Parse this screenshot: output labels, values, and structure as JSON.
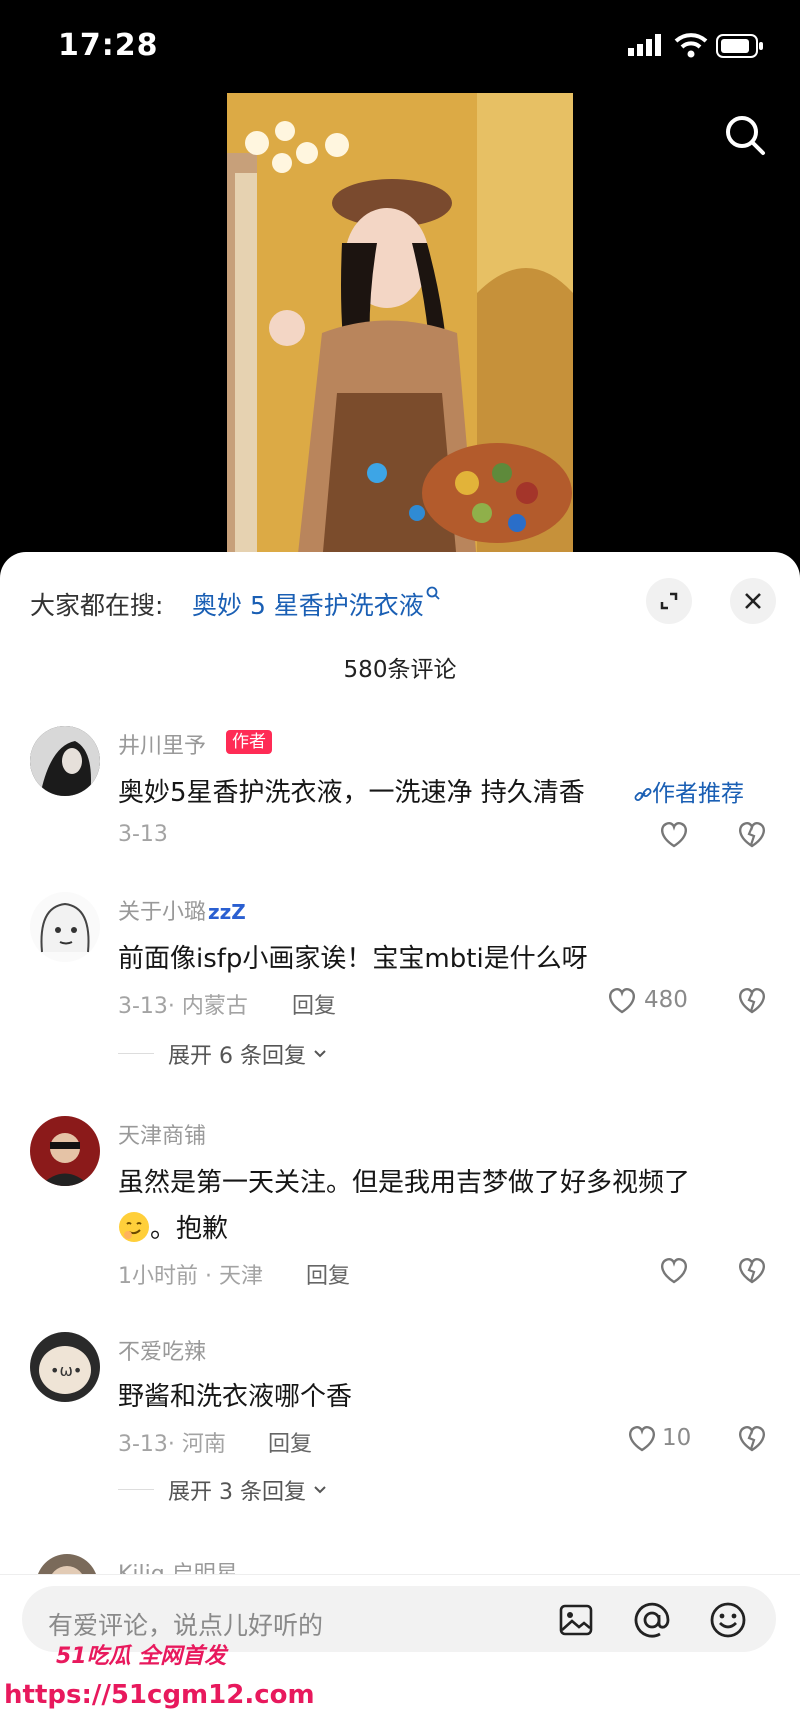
{
  "status_bar": {
    "time": "17:28"
  },
  "hot_search": {
    "label": "大家都在搜:",
    "term": "奥妙 5 星香护洗衣液"
  },
  "comment_count": "580条评论",
  "comments": [
    {
      "name": "井川里予",
      "badge": "作者",
      "text": "奥妙5星香护洗衣液，一洗速净 持久清香",
      "link": "作者推荐",
      "meta": "3-13"
    },
    {
      "name": "关于小璐",
      "name_suffix": "zzZ",
      "text": "前面像isfp小画家诶！宝宝mbti是什么呀",
      "meta": "3-13· 内蒙古",
      "reply": "回复",
      "likes": "480",
      "expand": "展开 6 条回复"
    },
    {
      "name": "天津商铺",
      "text_line1": "虽然是第一天关注。但是我用吉梦做了好多视频了",
      "text_line2": "。抱歉",
      "meta": "1小时前 · 天津",
      "reply": "回复"
    },
    {
      "name": "不爱吃辣",
      "text": "野酱和洗衣液哪个香",
      "meta": "3-13· 河南",
      "reply": "回复",
      "likes": "10",
      "expand": "展开 3 条回复"
    },
    {
      "name": "Kiliq 启明星"
    }
  ],
  "input": {
    "placeholder": "有爱评论，说点儿好听的"
  },
  "watermark": {
    "line1": "51吃瓜 全网首发",
    "line2": "https://51cgm12.com"
  },
  "colors": {
    "accent_link": "#1a5fb4",
    "badge": "#ff2b55",
    "watermark": "#e8195d"
  }
}
